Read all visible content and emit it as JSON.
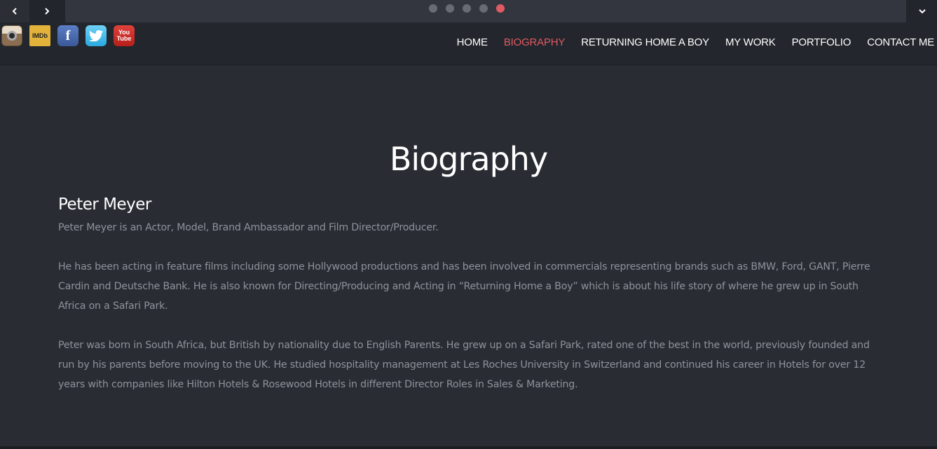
{
  "slider": {
    "dots": [
      {
        "active": false
      },
      {
        "active": false
      },
      {
        "active": false
      },
      {
        "active": false
      },
      {
        "active": true
      }
    ],
    "prev_icon": "chevron-left-icon",
    "next_icon": "chevron-right-icon",
    "expand_icon": "chevron-down-icon"
  },
  "social": {
    "instagram_icon": "instagram-icon",
    "imdb_label": "IMDb",
    "facebook_label": "f",
    "twitter_icon": "twitter-icon",
    "youtube_label_top": "You",
    "youtube_label_bottom": "Tube"
  },
  "nav": {
    "items": [
      "HOME",
      "BIOGRAPHY",
      "RETURNING HOME A BOY",
      "MY WORK",
      "PORTFOLIO",
      "CONTACT ME"
    ],
    "active": "BIOGRAPHY"
  },
  "main": {
    "title": "Biography",
    "name": "Peter Meyer",
    "paragraphs": [
      "Peter Meyer is an Actor, Model, Brand Ambassador and Film Director/Producer.",
      "He has been acting in feature films including some Hollywood productions and has been involved in commercials representing brands such as BMW, Ford, GANT, Pierre Cardin and Deutsche Bank. He is also known for Directing/Producing and Acting in “Returning Home a Boy” which is about his life story of where he grew up in South Africa on a Safari Park.",
      "Peter was born in South Africa, but British by nationality due to English Parents. He grew up on a Safari Park, rated one of the best in the world, previously founded and run by his parents before moving to the UK. He studied hospitality management at Les Roches University in Switzerland and continued his career in Hotels for over 12 years with companies like Hilton Hotels & Rosewood Hotels in different Director Roles in Sales & Marketing."
    ]
  },
  "colors": {
    "background": "#292c33",
    "header": "#23262c",
    "accent": "#e05a63",
    "body_text": "#8f929a"
  }
}
